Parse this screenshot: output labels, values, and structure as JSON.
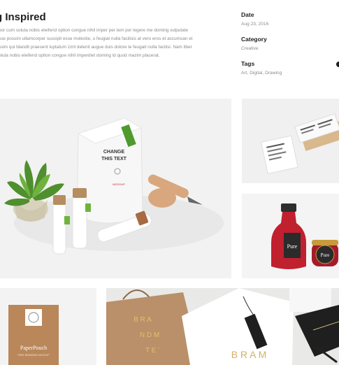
{
  "project": {
    "title": "g Inspired",
    "description": [
      "oor cum soluta nobis eleifend option congue nihil imper per tem por legere me doming vulputate",
      "sse possim ullamcorper suscipit esse molestie, u feugiat nulla facilisis at vero eros et accumsan et",
      "ssim qui blandit praesent luptatum zzril delenit augue duis dolore te feugait nulla facilisi. Nam liber",
      "oluta nobis eleifend option congue nihil imperdiet doming id quod mazim placerat."
    ]
  },
  "meta": {
    "date_label": "Date",
    "date_value": "Aug 23, 2016",
    "category_label": "Category",
    "category_value": "Creative",
    "tags_label": "Tags",
    "tags_value": "Art, Digital, Drawing"
  },
  "gallery": {
    "main": {
      "pack_text_1": "CHANGE",
      "pack_text_2": "THIS TEXT",
      "pack_tag": "MOCKUP"
    },
    "jar": {
      "bottle_label": "Pure",
      "jar_label": "Pure"
    },
    "pouch": {
      "brand_1": "PaperPouch",
      "brand_2": "FREE BRANDING MOCKUP"
    },
    "bag": {
      "bag_line_1": "B R A",
      "bag_line_2": "N D  M",
      "bag_line_3": "T E '",
      "shirt_text": "B R A M"
    }
  }
}
